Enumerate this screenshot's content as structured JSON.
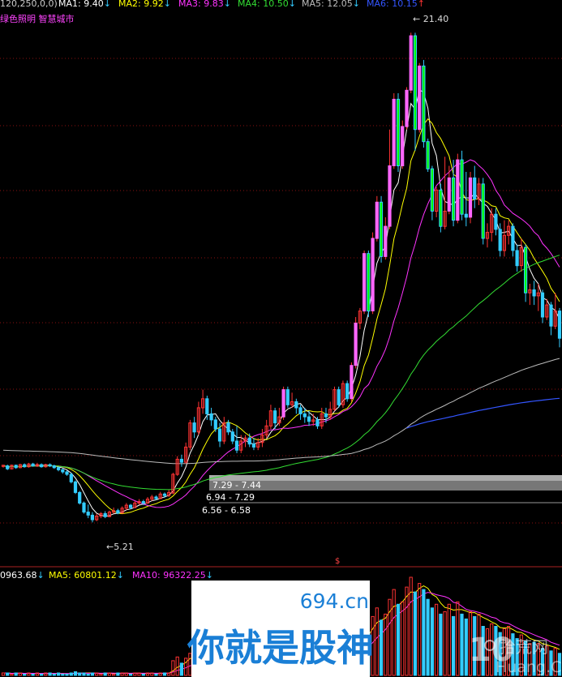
{
  "header": {
    "params": "120,250,0,0)",
    "ma_items": [
      {
        "label": "MA1: 9.40",
        "color": "#ffffff"
      },
      {
        "label": "MA2: 9.92",
        "color": "#ffff00"
      },
      {
        "label": "MA3: 9.83",
        "color": "#ff33ff"
      },
      {
        "label": "MA4: 10.50",
        "color": "#33dd33"
      },
      {
        "label": "MA5: 12.05",
        "color": "#bbbbbb"
      },
      {
        "label": "MA6: 10.15",
        "color": "#3355ff"
      }
    ],
    "down_arrow": "↓",
    "up_arrow": "↑",
    "concepts": "绿色照明 智慧城市"
  },
  "annotations": {
    "high": "21.40",
    "low": "5.21",
    "band1": "7.29 - 7.44",
    "band2": "6.94 - 7.29",
    "band3": "6.56 - 6.58",
    "dollar": "$"
  },
  "volume_header": {
    "items": [
      {
        "label": "0963.68",
        "color": "#ffffff"
      },
      {
        "label": "MA5: 60801.12",
        "color": "#ffff00"
      },
      {
        "label": "MA10: 96322.25",
        "color": "#ff33ff"
      }
    ]
  },
  "watermark": {
    "site": "694.cn",
    "slogan": "你就是股神",
    "logo_num": "10",
    "logo_text": "拾荒网",
    "logo_url": "Huang.CN"
  },
  "colors": {
    "up": "#ff3333",
    "up_fill": "#ff66ff",
    "down": "#33ccff",
    "down_fill": "#00ff00",
    "bg": "#000000"
  },
  "chart_data": {
    "type": "candlestick",
    "ylim": [
      4.2,
      22.0
    ],
    "candles": [
      [
        7.06,
        7.1,
        7.02,
        7.11
      ],
      [
        7.08,
        6.98,
        6.94,
        7.12
      ],
      [
        6.98,
        7.1,
        6.96,
        7.12
      ],
      [
        7.1,
        7.02,
        6.98,
        7.12
      ],
      [
        7.02,
        7.12,
        7.0,
        7.15
      ],
      [
        7.12,
        7.05,
        7.02,
        7.16
      ],
      [
        7.05,
        7.14,
        7.02,
        7.18
      ],
      [
        7.14,
        7.08,
        7.05,
        7.18
      ],
      [
        7.08,
        7.12,
        7.04,
        7.18
      ],
      [
        7.12,
        7.05,
        7.02,
        7.16
      ],
      [
        7.05,
        7.12,
        7.02,
        7.15
      ],
      [
        7.12,
        7.08,
        7.04,
        7.16
      ],
      [
        7.08,
        7.02,
        6.98,
        7.12
      ],
      [
        7.02,
        6.95,
        6.9,
        7.05
      ],
      [
        6.95,
        6.88,
        6.82,
        7.0
      ],
      [
        6.88,
        6.8,
        6.75,
        6.92
      ],
      [
        6.8,
        6.55,
        6.5,
        6.85
      ],
      [
        6.55,
        6.2,
        6.15,
        6.6
      ],
      [
        6.2,
        5.85,
        5.8,
        6.25
      ],
      [
        5.85,
        5.55,
        5.5,
        5.9
      ],
      [
        5.55,
        5.45,
        5.35,
        5.8
      ],
      [
        5.45,
        5.3,
        5.21,
        5.55
      ],
      [
        5.3,
        5.42,
        5.25,
        5.5
      ],
      [
        5.42,
        5.5,
        5.35,
        5.55
      ],
      [
        5.5,
        5.4,
        5.35,
        5.58
      ],
      [
        5.4,
        5.55,
        5.38,
        5.6
      ],
      [
        5.55,
        5.6,
        5.5,
        5.7
      ],
      [
        5.6,
        5.52,
        5.48,
        5.66
      ],
      [
        5.52,
        5.68,
        5.5,
        5.74
      ],
      [
        5.68,
        5.78,
        5.62,
        5.85
      ],
      [
        5.78,
        5.7,
        5.65,
        5.82
      ],
      [
        5.7,
        5.85,
        5.68,
        5.92
      ],
      [
        5.85,
        5.9,
        5.8,
        5.98
      ],
      [
        5.9,
        5.85,
        5.78,
        5.96
      ],
      [
        5.85,
        5.98,
        5.82,
        6.05
      ],
      [
        5.98,
        6.05,
        5.92,
        6.12
      ],
      [
        6.05,
        6.0,
        5.95,
        6.1
      ],
      [
        6.0,
        6.15,
        5.98,
        6.22
      ],
      [
        6.15,
        6.1,
        6.02,
        6.2
      ],
      [
        6.1,
        6.2,
        6.05,
        6.28
      ],
      [
        6.18,
        6.8,
        6.15,
        6.85
      ],
      [
        6.8,
        7.3,
        6.75,
        7.4
      ],
      [
        7.3,
        7.2,
        7.05,
        7.45
      ],
      [
        7.2,
        7.7,
        7.15,
        7.85
      ],
      [
        7.7,
        8.5,
        7.6,
        8.6
      ],
      [
        8.5,
        8.2,
        8.0,
        8.7
      ],
      [
        8.2,
        9.0,
        8.1,
        9.2
      ],
      [
        9.0,
        9.3,
        8.8,
        9.6
      ],
      [
        9.3,
        8.8,
        8.6,
        9.4
      ],
      [
        8.8,
        8.6,
        8.4,
        9.0
      ],
      [
        8.6,
        8.3,
        8.2,
        8.7
      ],
      [
        8.3,
        7.9,
        7.7,
        8.5
      ],
      [
        7.9,
        8.5,
        7.8,
        8.7
      ],
      [
        8.5,
        8.2,
        8.1,
        8.6
      ],
      [
        8.2,
        7.9,
        7.8,
        8.3
      ],
      [
        7.9,
        7.6,
        7.5,
        8.4
      ],
      [
        7.6,
        7.9,
        7.5,
        8.1
      ],
      [
        7.9,
        8.0,
        7.7,
        8.1
      ],
      [
        8.0,
        7.8,
        7.7,
        8.15
      ],
      [
        7.8,
        7.7,
        7.6,
        8.0
      ],
      [
        7.7,
        7.85,
        7.6,
        8.0
      ],
      [
        7.85,
        8.1,
        7.7,
        8.3
      ],
      [
        8.1,
        8.4,
        8.0,
        8.6
      ],
      [
        8.4,
        8.9,
        8.3,
        9.1
      ],
      [
        8.9,
        8.5,
        8.3,
        9.0
      ],
      [
        8.5,
        8.7,
        8.4,
        9.0
      ],
      [
        8.7,
        9.6,
        8.6,
        9.7
      ],
      [
        9.6,
        9.1,
        9.0,
        9.7
      ],
      [
        9.1,
        9.2,
        9.0,
        9.5
      ],
      [
        9.2,
        9.0,
        8.8,
        9.3
      ],
      [
        9.0,
        8.8,
        8.6,
        9.1
      ],
      [
        8.8,
        8.7,
        8.5,
        9.0
      ],
      [
        8.7,
        8.55,
        8.4,
        8.9
      ],
      [
        8.55,
        8.6,
        8.4,
        8.8
      ],
      [
        8.6,
        8.4,
        8.3,
        8.7
      ],
      [
        8.4,
        8.8,
        8.3,
        9.0
      ],
      [
        8.8,
        8.7,
        8.5,
        9.0
      ],
      [
        8.7,
        8.95,
        8.6,
        9.2
      ],
      [
        8.95,
        9.6,
        8.9,
        9.7
      ],
      [
        9.6,
        9.1,
        9.0,
        9.7
      ],
      [
        9.1,
        9.8,
        9.0,
        9.9
      ],
      [
        9.8,
        9.3,
        9.2,
        9.9
      ],
      [
        9.3,
        10.4,
        9.2,
        10.5
      ],
      [
        10.4,
        11.8,
        10.3,
        12.0
      ],
      [
        11.8,
        12.2,
        11.6,
        12.3
      ],
      [
        12.2,
        14.1,
        12.1,
        14.2
      ],
      [
        14.1,
        12.2,
        12.0,
        14.2
      ],
      [
        12.2,
        14.6,
        12.1,
        14.8
      ],
      [
        14.6,
        15.8,
        14.5,
        16.0
      ],
      [
        15.8,
        14.0,
        13.8,
        16.0
      ],
      [
        14.0,
        15.0,
        13.9,
        15.3
      ],
      [
        15.0,
        17.0,
        14.9,
        18.2
      ],
      [
        17.0,
        19.2,
        16.9,
        19.4
      ],
      [
        19.2,
        17.0,
        16.8,
        19.4
      ],
      [
        17.0,
        18.3,
        16.9,
        18.5
      ],
      [
        18.3,
        19.5,
        18.2,
        19.6
      ],
      [
        19.5,
        21.3,
        19.4,
        21.4
      ],
      [
        21.3,
        18.2,
        17.5,
        21.4
      ],
      [
        18.2,
        20.3,
        18.1,
        20.4
      ],
      [
        20.3,
        17.8,
        17.6,
        20.5
      ],
      [
        17.8,
        16.9,
        16.8,
        17.9
      ],
      [
        16.9,
        15.5,
        15.2,
        17.0
      ],
      [
        15.5,
        16.2,
        15.3,
        16.3
      ],
      [
        16.2,
        15.0,
        14.8,
        16.4
      ],
      [
        15.0,
        15.5,
        14.9,
        17.3
      ],
      [
        15.5,
        16.6,
        15.4,
        17.0
      ],
      [
        16.6,
        15.2,
        15.0,
        17.2
      ],
      [
        15.2,
        17.2,
        15.1,
        17.4
      ],
      [
        17.2,
        15.4,
        15.2,
        17.5
      ],
      [
        15.4,
        15.3,
        15.0,
        16.8
      ],
      [
        15.3,
        16.6,
        15.1,
        16.8
      ],
      [
        16.6,
        15.9,
        15.6,
        17.0
      ],
      [
        15.9,
        16.4,
        15.7,
        16.6
      ],
      [
        16.4,
        14.6,
        14.4,
        16.6
      ],
      [
        14.6,
        14.8,
        14.3,
        15.1
      ],
      [
        14.8,
        15.4,
        14.5,
        15.6
      ],
      [
        15.4,
        14.9,
        14.7,
        15.6
      ],
      [
        14.9,
        14.2,
        14.0,
        15.1
      ],
      [
        14.2,
        14.7,
        14.0,
        15.2
      ],
      [
        14.7,
        15.0,
        14.4,
        15.2
      ],
      [
        15.0,
        14.2,
        14.0,
        15.1
      ],
      [
        14.2,
        13.7,
        13.5,
        14.4
      ],
      [
        13.7,
        14.3,
        13.5,
        14.6
      ],
      [
        14.3,
        12.8,
        12.5,
        14.4
      ],
      [
        12.8,
        12.9,
        12.4,
        13.1
      ],
      [
        12.9,
        12.7,
        12.4,
        13.2
      ],
      [
        12.7,
        12.8,
        12.2,
        13.1
      ],
      [
        12.8,
        12.0,
        11.8,
        12.9
      ],
      [
        12.0,
        12.4,
        11.9,
        12.6
      ],
      [
        12.4,
        11.7,
        11.4,
        12.5
      ],
      [
        11.7,
        12.2,
        11.6,
        12.8
      ],
      [
        12.2,
        11.3,
        11.0,
        12.3
      ]
    ],
    "volume": [
      2,
      2,
      1,
      2,
      2,
      1,
      2,
      1,
      2,
      1,
      2,
      2,
      1,
      2,
      1,
      1,
      2,
      3,
      2,
      2,
      1,
      2,
      2,
      1,
      2,
      2,
      1,
      2,
      2,
      2,
      1,
      2,
      2,
      1,
      2,
      2,
      1,
      2,
      2,
      2,
      12,
      15,
      10,
      14,
      18,
      12,
      16,
      20,
      14,
      12,
      10,
      9,
      11,
      10,
      9,
      8,
      10,
      9,
      8,
      9,
      10,
      12,
      14,
      18,
      13,
      15,
      20,
      16,
      14,
      12,
      10,
      9,
      8,
      9,
      8,
      10,
      9,
      11,
      15,
      12,
      16,
      12,
      22,
      30,
      35,
      42,
      35,
      48,
      55,
      45,
      50,
      62,
      70,
      58,
      60,
      72,
      80,
      68,
      75,
      70,
      62,
      55,
      58,
      50,
      52,
      58,
      48,
      60,
      50,
      46,
      52,
      48,
      50,
      40,
      38,
      42,
      40,
      35,
      38,
      40,
      34,
      30,
      33,
      28,
      26,
      27,
      26,
      22,
      24,
      20,
      22,
      18
    ]
  }
}
